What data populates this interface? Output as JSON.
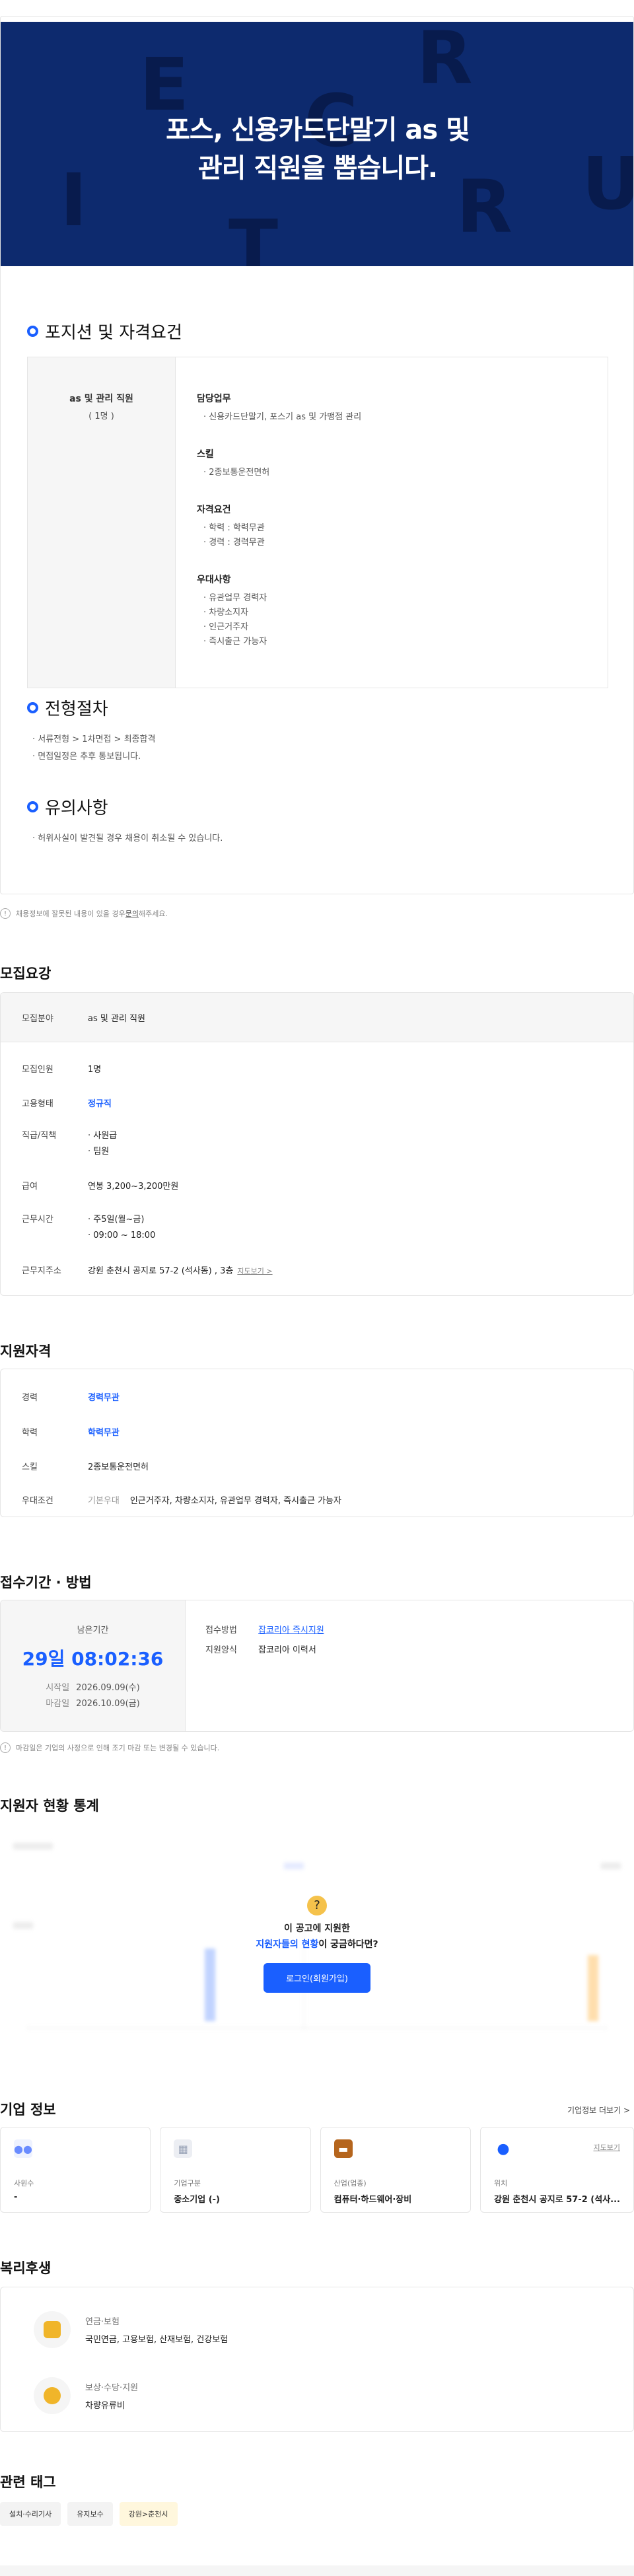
{
  "hero": {
    "letters": [
      "E",
      "R",
      "C",
      "I",
      "U",
      "T",
      "R"
    ],
    "title_line1": "포스, 신용카드단말기 as 및",
    "title_line2": "관리 직원을 뽑습니다."
  },
  "position": {
    "heading": "포지션 및 자격요건",
    "job_name": "as 및 관리 직원",
    "job_count": "( 1명 )",
    "duties_title": "담당업무",
    "duties": [
      "· 신용카드단말기, 포스기 as 및 가맹점 관리"
    ],
    "skills_title": "스킬",
    "skills": [
      "· 2종보통운전면허"
    ],
    "req_title": "자격요건",
    "reqs": [
      "· 학력 : 학력무관",
      "· 경력 : 경력무관"
    ],
    "pref_title": "우대사항",
    "prefs": [
      "· 유관업무 경력자",
      "· 차량소지자",
      "· 인근거주자",
      "· 즉시출근 가능자"
    ]
  },
  "process": {
    "heading": "전형절차",
    "lines": [
      "· 서류전형 > 1차면접 > 최종합격",
      "· 면접일정은 추후 통보됩니다."
    ]
  },
  "caution": {
    "heading": "유의사항",
    "lines": [
      "· 허위사실이 발견될 경우 채용이 취소될 수 있습니다."
    ]
  },
  "report_note": {
    "text": "채용정보에 잘못된 내용이 있을 경우 ",
    "link": "문의",
    "tail": "해주세요."
  },
  "recruit": {
    "heading": "모집요강",
    "field_k": "모집분야",
    "field_v": "as 및 관리 직원",
    "count_k": "모집인원",
    "count_v": "1명",
    "type_k": "고용형태",
    "type_v": "정규직",
    "rank_k": "직급/직책",
    "rank_v": [
      "· 사원급",
      "· 팀원"
    ],
    "pay_k": "급여",
    "pay_v": "연봉 3,200~3,200만원",
    "time_k": "근무시간",
    "time_v": [
      "· 주5일(월~금)",
      "· 09:00 ~ 18:00"
    ],
    "addr_k": "근무지주소",
    "addr_v": "강원 춘천시 공지로 57-2 (석사동) , 3층",
    "addr_link": "지도보기 >"
  },
  "qual": {
    "heading": "지원자격",
    "career_k": "경력",
    "career_v": "경력무관",
    "edu_k": "학력",
    "edu_v": "학력무관",
    "skill_k": "스킬",
    "skill_v": "2종보통운전면허",
    "pref_k": "우대조건",
    "pref_tag": "기본우대",
    "pref_v": "인근거주자, 차량소지자, 유관업무 경력자, 즉시출근 가능자"
  },
  "apply": {
    "heading": "접수기간 · 방법",
    "remaining_label": "남은기간",
    "remaining": "29일 08:02:36",
    "start_k": "시작일",
    "start_v": "2026.09.09(수)",
    "end_k": "마감일",
    "end_v": "2026.10.09(금)",
    "method_k": "접수방법",
    "method_v": "잡코리아 즉시지원",
    "form_k": "지원양식",
    "form_v": "잡코리아 이력서",
    "note": "마감일은 기업의 사정으로 인해 조기 마감 또는 변경될 수 있습니다."
  },
  "stats": {
    "heading": "지원자 현황 통계",
    "line1": "이 공고에 지원한",
    "line2a": "지원자들의 현황",
    "line2b": "이 궁금하다면?",
    "button": "로그인(회원가입)"
  },
  "company": {
    "heading": "기업 정보",
    "more": "기업정보 더보기 >",
    "cards": [
      {
        "label": "사원수",
        "value": "-",
        "color": "#6a8cff"
      },
      {
        "label": "기업구분",
        "value": "중소기업 (-)",
        "color": "#9aa4b8"
      },
      {
        "label": "산업(업종)",
        "value": "컴퓨터·하드웨어·장비",
        "color": "#b5651d"
      },
      {
        "label": "위치",
        "value": "강원 춘천시 공지로 57-2 (석사...",
        "color": "#1a5fff",
        "map": "지도보기"
      }
    ]
  },
  "welfare": {
    "heading": "복리후생",
    "items": [
      {
        "title": "연금·보험",
        "desc": "국민연금, 고용보험, 산재보험, 건강보험"
      },
      {
        "title": "보상·수당·지원",
        "desc": "차량유류비"
      }
    ]
  },
  "tags": {
    "heading": "관련 태그",
    "items": [
      "설치·수리기사",
      "유지보수",
      "강원>춘천시"
    ]
  }
}
